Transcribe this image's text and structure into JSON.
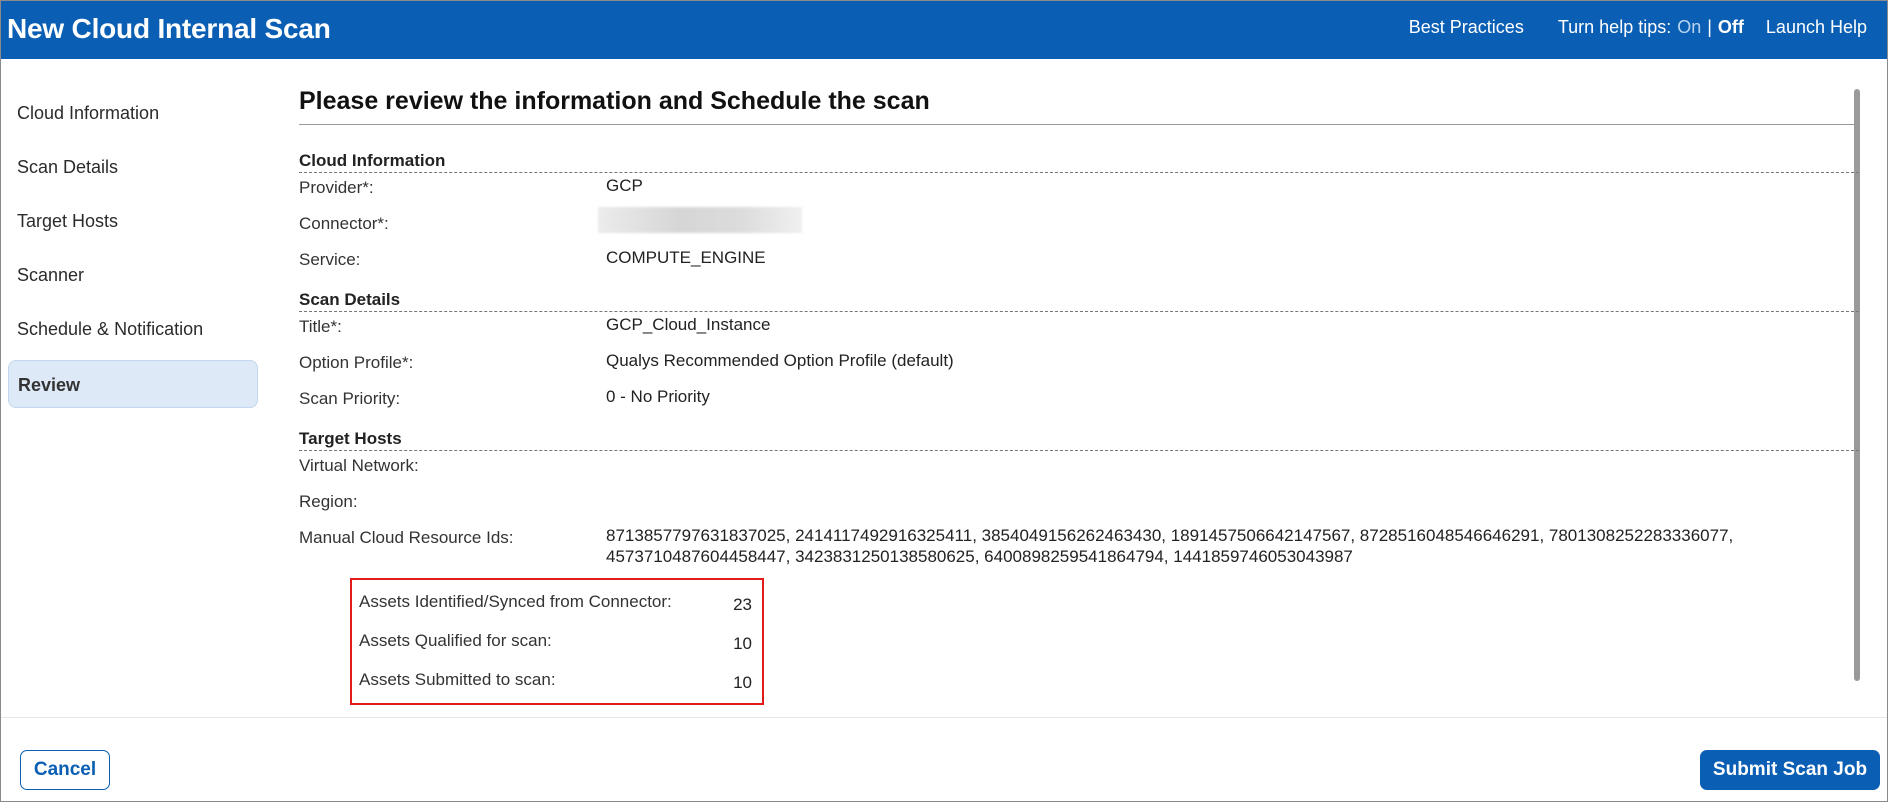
{
  "window": {
    "title": "New Cloud Internal Scan"
  },
  "header": {
    "best_practices": "Best Practices",
    "help_tips_label": "Turn help tips:",
    "help_tips_on": "On",
    "help_tips_sep": "|",
    "help_tips_off": "Off",
    "launch_help": "Launch Help"
  },
  "sidebar": {
    "items": [
      {
        "label": "Cloud Information",
        "active": false
      },
      {
        "label": "Scan Details",
        "active": false
      },
      {
        "label": "Target Hosts",
        "active": false
      },
      {
        "label": "Scanner",
        "active": false
      },
      {
        "label": "Schedule & Notification",
        "active": false
      },
      {
        "label": "Review",
        "active": true
      }
    ]
  },
  "main": {
    "heading": "Please review the information and Schedule the scan",
    "cloud_information": {
      "title": "Cloud Information",
      "provider_label": "Provider*:",
      "provider_value": "GCP",
      "connector_label": "Connector*:",
      "service_label": "Service:",
      "service_value": "COMPUTE_ENGINE"
    },
    "scan_details": {
      "title": "Scan Details",
      "title_label": "Title*:",
      "title_value": "GCP_Cloud_Instance",
      "option_profile_label": "Option Profile*:",
      "option_profile_value": "Qualys Recommended Option Profile (default)",
      "priority_label": "Scan Priority:",
      "priority_value": "0 - No Priority"
    },
    "target_hosts": {
      "title": "Target Hosts",
      "virtual_network_label": "Virtual Network:",
      "region_label": "Region:",
      "resource_ids_label": "Manual Cloud Resource Ids:",
      "resource_ids_value": "8713857797631837025, 2414117492916325411, 3854049156262463430, 1891457506642147567, 8728516048546646291, 7801308252283336077, 4573710487604458447, 3423831250138580625, 6400898259541864794, 1441859746053043987"
    },
    "assets": {
      "identified_label": "Assets Identified/Synced from Connector:",
      "identified_value": "23",
      "qualified_label": "Assets Qualified for scan:",
      "qualified_value": "10",
      "submitted_label": "Assets Submitted to scan:",
      "submitted_value": "10"
    }
  },
  "footer": {
    "cancel_label": "Cancel",
    "submit_label": "Submit Scan Job"
  },
  "colors": {
    "header_bg": "#0a5fb4",
    "sidebar_bg": "#ffffff",
    "content_bg": "#e9eff7",
    "active_item_bg": "#dde9f6",
    "highlight_border": "#e21a1a"
  }
}
